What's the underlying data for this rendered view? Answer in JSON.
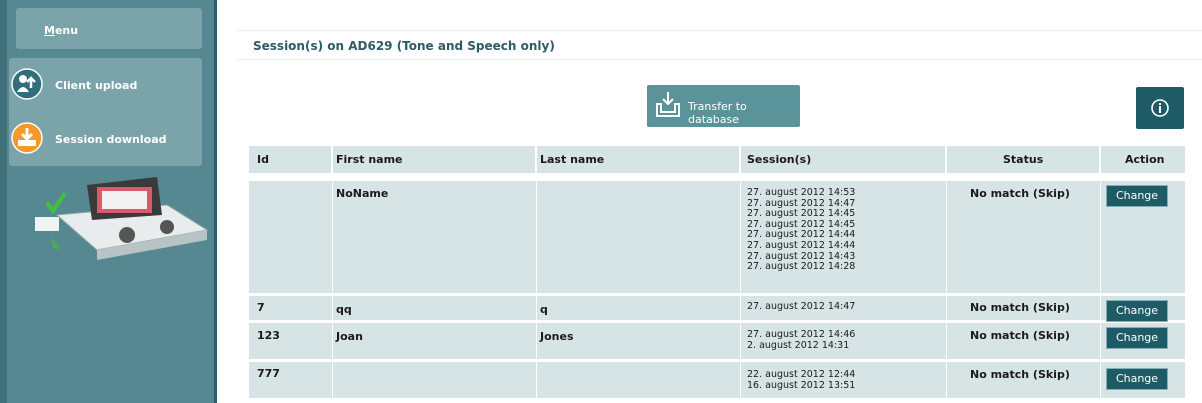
{
  "sidebar": {
    "menu_label": "Menu",
    "items": [
      {
        "label": "Client upload",
        "icon": "client-upload-icon"
      },
      {
        "label": "Session download",
        "icon": "session-download-icon"
      }
    ]
  },
  "panel": {
    "title": "Session(s) on AD629 (Tone and Speech only)",
    "transfer_label": "Transfer to database"
  },
  "table": {
    "headers": {
      "id": "Id",
      "first": "First name",
      "last": "Last name",
      "sessions": "Session(s)",
      "status": "Status",
      "action": "Action"
    },
    "rows": [
      {
        "id": "",
        "first": "NoName",
        "last": "",
        "sessions": [
          "27. august 2012 14:53",
          "27. august 2012 14:47",
          "27. august 2012 14:45",
          "27. august 2012 14:45",
          "27. august 2012 14:44",
          "27. august 2012 14:44",
          "27. august 2012 14:43",
          "27. august 2012 14:28"
        ],
        "status": "No match (Skip)",
        "action": "Change"
      },
      {
        "id": "7",
        "first": "qq",
        "last": "q",
        "sessions": [
          "27. august 2012 14:47"
        ],
        "status": "No match (Skip)",
        "action": "Change"
      },
      {
        "id": "123",
        "first": "Joan",
        "last": "Jones",
        "sessions": [
          "27. august 2012 14:46",
          "2. august 2012 14:31"
        ],
        "status": "No match (Skip)",
        "action": "Change"
      },
      {
        "id": "777",
        "first": "",
        "last": "",
        "sessions": [
          "22. august 2012 12:44",
          "16. august 2012 13:51"
        ],
        "status": "No match (Skip)",
        "action": "Change"
      }
    ]
  },
  "colors": {
    "sidebar": "#558891",
    "accent": "#1f5b66",
    "row_bg": "#d7e4e6",
    "title_text": "#2d5b66"
  }
}
